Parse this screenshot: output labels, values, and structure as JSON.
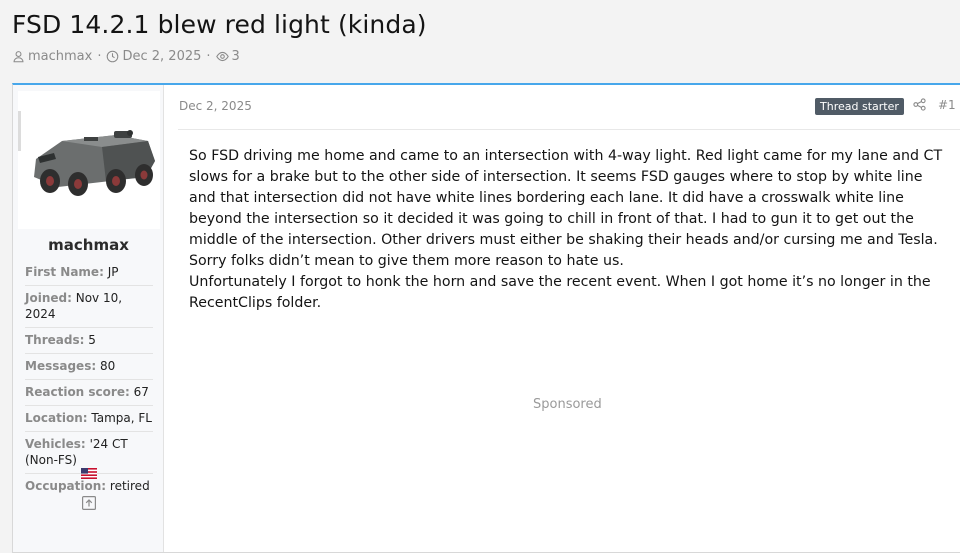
{
  "thread": {
    "title": "FSD 14.2.1 blew red light (kinda)",
    "author": "machmax",
    "date": "Dec 2, 2025",
    "views": "3"
  },
  "user": {
    "name": "machmax",
    "stats": [
      {
        "key": "First Name:",
        "value": "JP"
      },
      {
        "key": "Joined:",
        "value": "Nov 10, 2024"
      },
      {
        "key": "Threads:",
        "value": "5"
      },
      {
        "key": "Messages:",
        "value": "80"
      },
      {
        "key": "Reaction score:",
        "value": "67"
      },
      {
        "key": "Location:",
        "value": "Tampa, FL"
      },
      {
        "key": "Vehicles:",
        "value": "'24 CT (Non-FS)"
      },
      {
        "key": "Occupation:",
        "value": "retired"
      }
    ]
  },
  "post": {
    "date": "Dec 2, 2025",
    "badge": "Thread starter",
    "number": "#1",
    "paragraphs": [
      "So FSD driving me home and came to an intersection with 4-way light. Red light came for my lane and CT slows for a brake but to the other side of intersection. It seems FSD gauges where to stop by white line and that intersection did not have white lines bordering each lane. It did have a crosswalk white line beyond the intersection so it decided it was going to chill in front of that. I had to gun it to get out the middle of the intersection. Other drivers must either be shaking their heads and/or cursing me and Tesla. Sorry folks didn’t mean to give them more reason to hate us.",
      "Unfortunately I forgot to honk the horn and save the recent event. When I got home it’s no longer in the RecentClips folder."
    ],
    "sponsored": "Sponsored"
  },
  "colors": {
    "accent": "#47a7eb",
    "badge": "#505b66"
  }
}
